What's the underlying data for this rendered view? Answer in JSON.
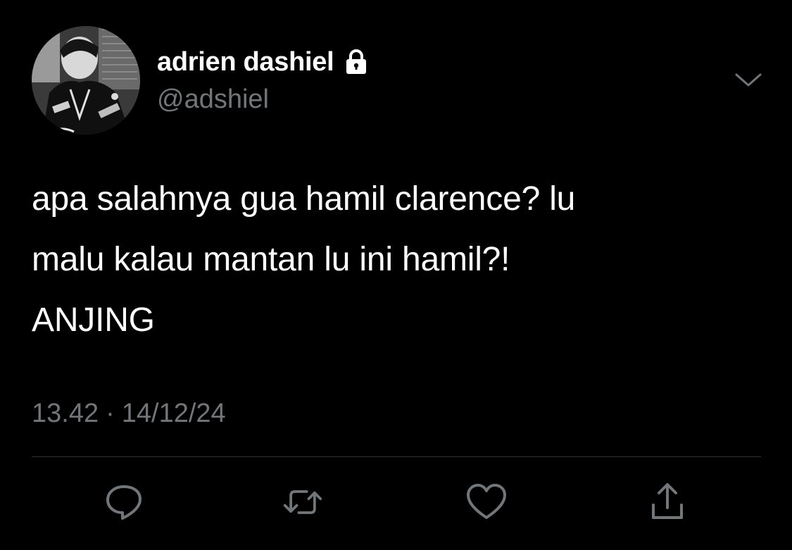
{
  "user": {
    "display_name": "adrien dashiel",
    "handle": "@adshiel",
    "protected_icon": "lock-icon",
    "avatar": "profile-photo"
  },
  "tweet": {
    "lines": [
      "apa salahnya gua hamil clarence? lu",
      "malu kalau mantan lu ini hamil?!",
      "ANJING"
    ],
    "time": "13.42",
    "separator": "·",
    "date": "14/12/24"
  },
  "actions": [
    {
      "name": "reply",
      "icon": "reply-icon"
    },
    {
      "name": "retweet",
      "icon": "retweet-icon"
    },
    {
      "name": "like",
      "icon": "heart-icon"
    },
    {
      "name": "share",
      "icon": "share-icon"
    }
  ],
  "menu_icon": "chevron-down-icon",
  "colors": {
    "background": "#000000",
    "text": "#ffffff",
    "secondary": "#71767b",
    "divider": "#2f3336"
  }
}
